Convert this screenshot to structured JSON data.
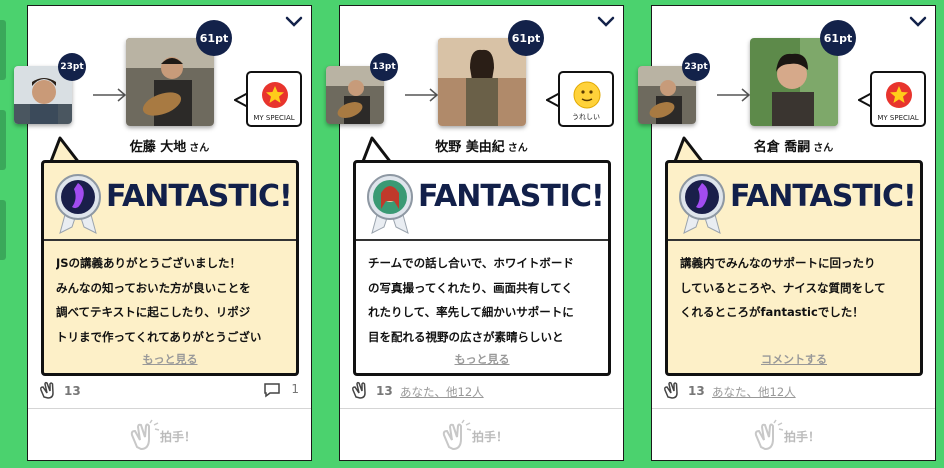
{
  "colors": {
    "background": "#4bd26e",
    "point_badge": "#13224a",
    "bubble_fill": "#fdf0c8",
    "title_navy": "#12204a"
  },
  "cards": [
    {
      "receiver_points": "61pt",
      "sender_points": "23pt",
      "stamp": {
        "icon": "star-icon",
        "label": "MY SPECIAL"
      },
      "receiver_name": "佐藤 大地",
      "honorific": "さん",
      "award_title": "FANTASTIC!",
      "badge": "purple-medal-icon",
      "message": "JSの講義ありがとうございました！\nみんなの知っておいた方が良いことを\n調べてテキストに起こしたり、リポジ\nトリまで作ってくれてありがとうござい",
      "link": "もっと見る",
      "clap_count": "13",
      "clap_users": "",
      "comment_count": "1",
      "applaud_label": "拍手！"
    },
    {
      "receiver_points": "61pt",
      "sender_points": "13pt",
      "stamp": {
        "icon": "smile-icon",
        "label": "うれしい"
      },
      "receiver_name": "牧野 美由紀",
      "honorific": "さん",
      "award_title": "FANTASTIC!",
      "badge": "green-medal-icon",
      "message": "チームでの話し合いで、ホワイトボード\nの写真撮ってくれたり、画面共有してく\nれたりして、率先して細かいサポートに\n目を配れる視野の広さが素晴らしいと",
      "link": "もっと見る",
      "clap_count": "13",
      "clap_users": "あなた、他12人",
      "comment_count": "",
      "applaud_label": "拍手！"
    },
    {
      "receiver_points": "61pt",
      "sender_points": "23pt",
      "stamp": {
        "icon": "star-icon",
        "label": "MY SPECIAL"
      },
      "receiver_name": "名倉 喬嗣",
      "honorific": "さん",
      "award_title": "FANTASTIC!",
      "badge": "purple-medal-icon",
      "message": "講義内でみんなのサポートに回ったり\nしているところや、ナイスな質問をして\nくれるところがfantasticでした！",
      "link": "コメントする",
      "clap_count": "13",
      "clap_users": "あなた、他12人",
      "comment_count": "",
      "applaud_label": "拍手！"
    }
  ]
}
